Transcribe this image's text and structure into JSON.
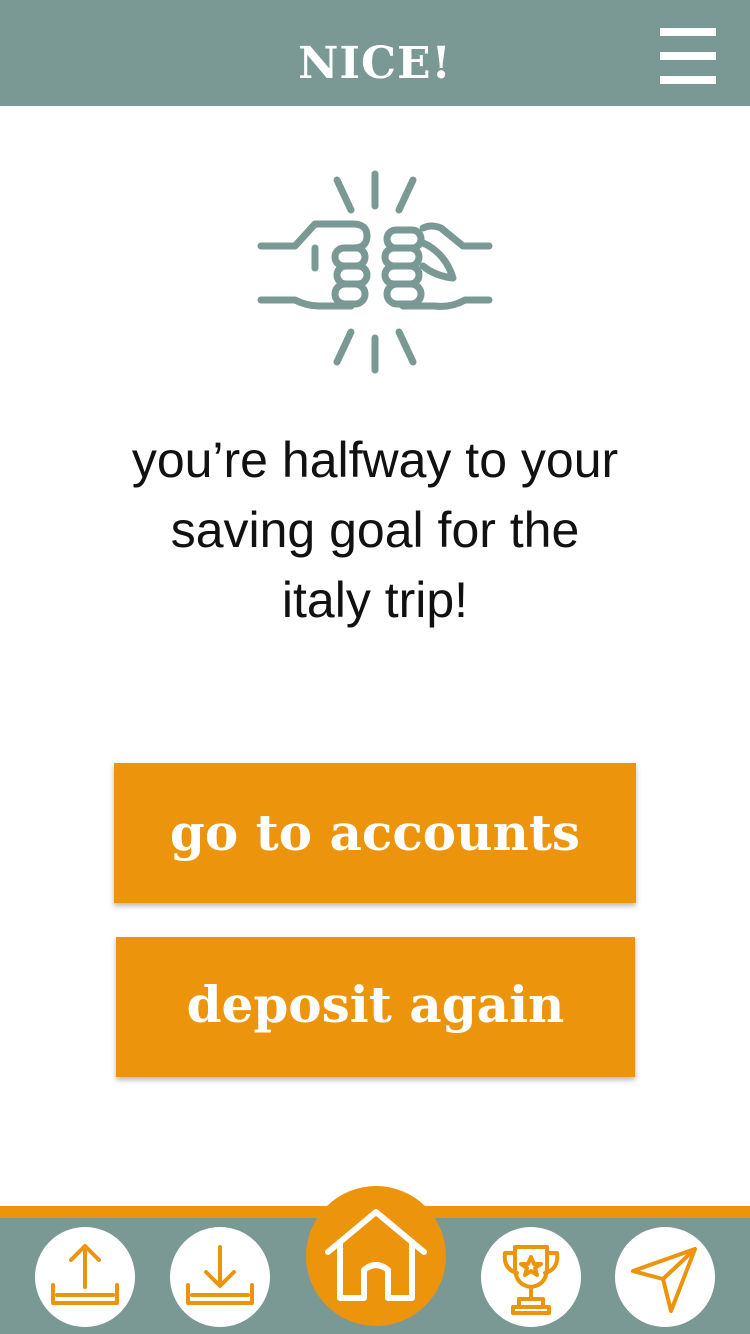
{
  "header": {
    "title": "NICE!",
    "menu_icon": "hamburger-menu-icon"
  },
  "celebration_icon": "fist-bump-icon",
  "message": {
    "lines": [
      "you’re halfway to your",
      "saving goal for the",
      "italy trip!"
    ]
  },
  "actions": {
    "accounts_label": "go to accounts",
    "deposit_label": "deposit again"
  },
  "tabbar": {
    "items": [
      {
        "icon": "upload-icon"
      },
      {
        "icon": "download-icon"
      },
      {
        "icon": "home-icon",
        "active": true
      },
      {
        "icon": "trophy-icon"
      },
      {
        "icon": "send-icon"
      }
    ]
  },
  "colors": {
    "header_bg": "#7a9894",
    "accent": "#ec940c",
    "icon_gray": "#7a9894",
    "text": "#111111"
  }
}
